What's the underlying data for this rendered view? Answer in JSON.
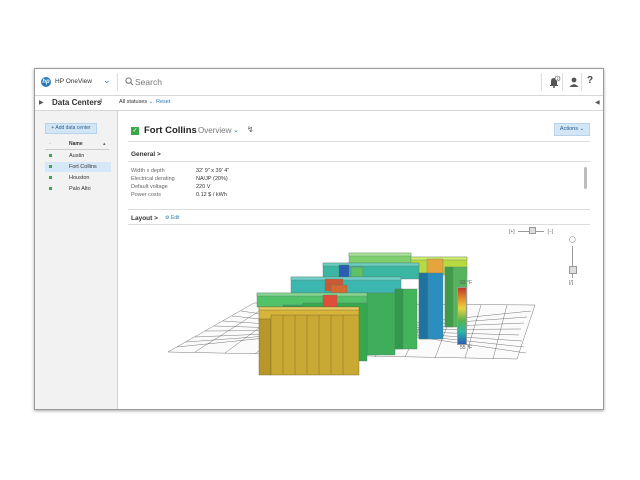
{
  "app": {
    "name": "HP OneView",
    "logo_text": "hp"
  },
  "search": {
    "placeholder": "Search"
  },
  "toolbar": {
    "notifications_count": "2",
    "help_label": "?"
  },
  "section": {
    "title": "Data Centers",
    "count": "4",
    "status_filter": "All statuses",
    "reset_label": "Reset"
  },
  "sidebar": {
    "add_label": "+ Add data center",
    "column_header": "Name",
    "items": [
      {
        "label": "Austin"
      },
      {
        "label": "Fort Collins"
      },
      {
        "label": "Houston"
      },
      {
        "label": "Palo Alto"
      }
    ]
  },
  "main": {
    "title": "Fort Collins",
    "view": "Overview",
    "actions_label": "Actions",
    "general_heading": "General >",
    "properties": [
      {
        "label": "Width x depth",
        "value": "32' 9\" x 39' 4\""
      },
      {
        "label": "Electrical derating",
        "value": "NA/JP (20%)"
      },
      {
        "label": "Default voltage",
        "value": "220 V"
      },
      {
        "label": "Power costs",
        "value": "0.12 $ / kWh"
      }
    ],
    "layout_heading": "Layout >",
    "edit_label": "Edit"
  },
  "legend": {
    "max": "93 °F",
    "min": "55 °F"
  },
  "colors": {
    "accent": "#2a7ab8",
    "status_ok": "#3aa84a"
  }
}
